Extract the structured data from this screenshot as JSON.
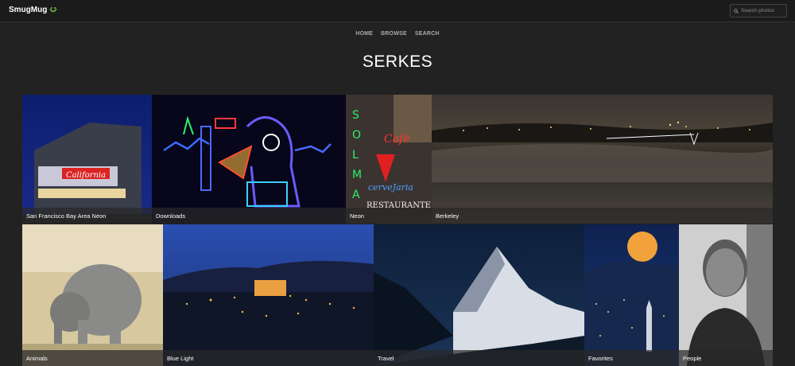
{
  "header": {
    "logo_text": "SmugMug",
    "search_placeholder": "Search photos"
  },
  "nav": {
    "items": [
      "HOME",
      "BROWSE",
      "SEARCH"
    ]
  },
  "page_title": "SERKES",
  "galleries": [
    {
      "label": "San Francisco Bay Area Neon"
    },
    {
      "label": "Downloads"
    },
    {
      "label": "Neon"
    },
    {
      "label": "Berkeley"
    },
    {
      "label": "Animals"
    },
    {
      "label": "Blue Light"
    },
    {
      "label": "Travel"
    },
    {
      "label": "Favorites"
    },
    {
      "label": "People"
    }
  ],
  "colors": {
    "background": "#222222",
    "topbar": "#1b1b1b",
    "logo_accent": "#6fbf3f"
  }
}
